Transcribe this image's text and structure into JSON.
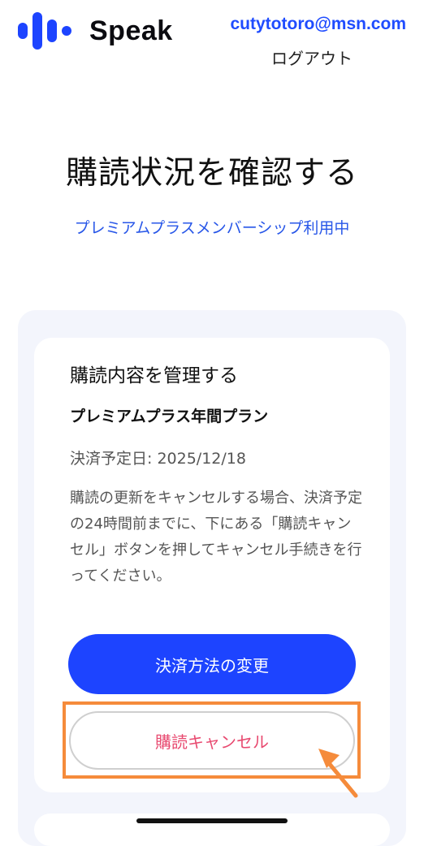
{
  "header": {
    "brand": "Speak",
    "account_email": "cutytotoro@msn.com",
    "logout_label": "ログアウト"
  },
  "page": {
    "title": "購読状況を確認する",
    "plan_status": "プレミアムプラスメンバーシップ利用中"
  },
  "subscription": {
    "card_title": "購読内容を管理する",
    "plan_name": "プレミアムプラス年間プラン",
    "next_payment": "決済予定日: 2025/12/18",
    "notice": "購読の更新をキャンセルする場合、決済予定の24時間前までに、下にある「購読キャンセル」ボタンを押してキャンセル手続きを行ってください。",
    "change_payment_label": "決済方法の変更",
    "cancel_label": "購読キャンセル"
  },
  "colors": {
    "brand_blue": "#1d44ff",
    "link_blue": "#2756e8",
    "cancel_pink": "#e84a70",
    "highlight_orange": "#f58b3b"
  },
  "icons": {
    "logo": "speak-logo-icon",
    "annotation": "arrow-icon"
  }
}
